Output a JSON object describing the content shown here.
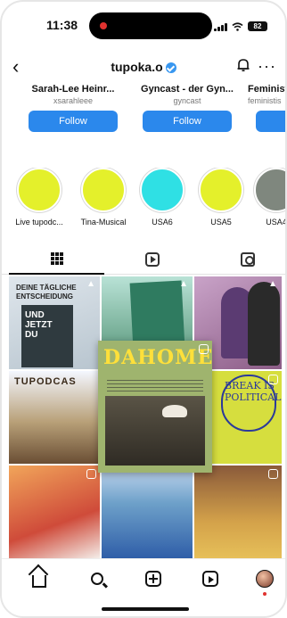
{
  "status_bar": {
    "time": "11:38",
    "battery": "82"
  },
  "header": {
    "handle": "tupoka.o"
  },
  "suggested": [
    {
      "name": "Sarah-Lee Heinr...",
      "username": "xsarahleee",
      "button": "Follow"
    },
    {
      "name": "Gyncast - der Gyn...",
      "username": "gyncast",
      "button": "Follow"
    },
    {
      "name": "Feminist",
      "username": "feministis",
      "button": "Follow"
    }
  ],
  "highlights": [
    {
      "label": "Live tupodc...",
      "color": "#e4f02b"
    },
    {
      "label": "Tina-Musical",
      "color": "#e4f02b"
    },
    {
      "label": "USA6",
      "color": "#2fe0e4"
    },
    {
      "label": "USA5",
      "color": "#e4f02b"
    },
    {
      "label": "USA4",
      "color": "#7f877e"
    }
  ],
  "posts": {
    "p1_title": "DEINE TÄGLICHE ENTSCHEIDUNG",
    "p1_book": "UND JETZT DU",
    "p4_title": "TUPODCAS",
    "p5_title": "DAHOMEY",
    "p6_text": "BREAK IS POLITICAL"
  },
  "colors": {
    "accent": "#2b88ec"
  }
}
